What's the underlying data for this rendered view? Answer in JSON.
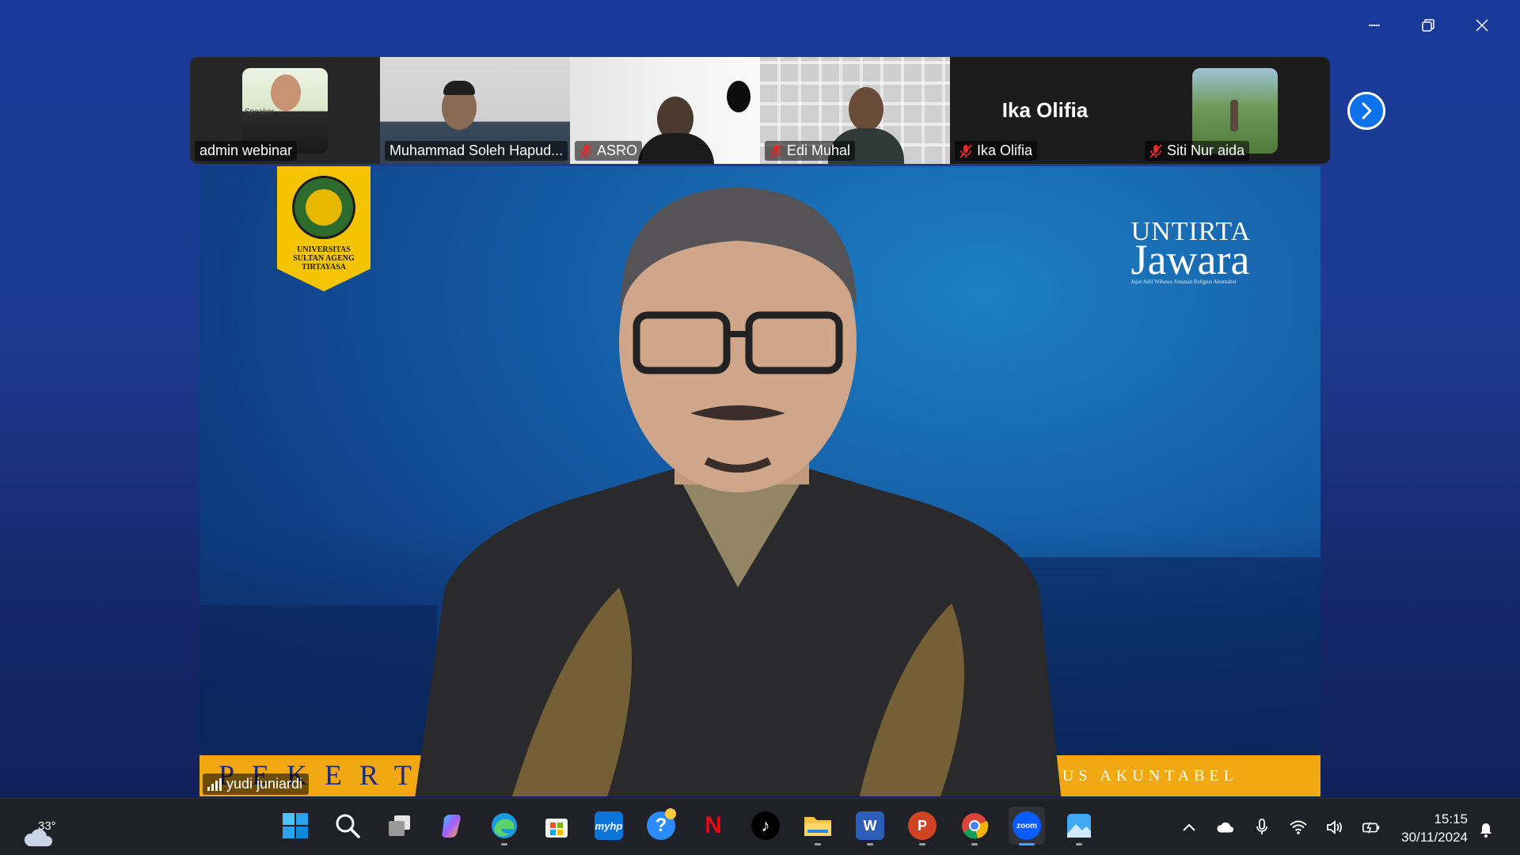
{
  "window_controls": {
    "minimize_label": "—",
    "restore_label": "❐",
    "close_label": "✕"
  },
  "participants": [
    {
      "name": "admin webinar",
      "muted": false,
      "photo_text": "Speaker"
    },
    {
      "name": "Muhammad Soleh Hapud...",
      "muted": false
    },
    {
      "name": "ASRO",
      "muted": true
    },
    {
      "name": "Edi Muhal",
      "muted": true
    },
    {
      "name": "Ika Olifia",
      "muted": true,
      "center_name": "Ika Olifia"
    },
    {
      "name": "Siti Nur aida",
      "muted": true
    }
  ],
  "main_video": {
    "speaker_name": "yudi juniardi",
    "logo_text_lines": [
      "UNIVERSITAS",
      "SULTAN AGENG",
      "TIRTAYASA"
    ],
    "brand_line1": "UNTIRTA",
    "brand_line2": "Jawara",
    "brand_tagline": "Jujur Adil Wibawa Amanah Religius Akuntabel",
    "band_left": "PEKERTI",
    "band_right": "US AKUNTABEL"
  },
  "taskbar": {
    "weather_temp": "33°",
    "apps": [
      {
        "id": "start",
        "icon": "windows-start-icon",
        "color": "#3aa0ff",
        "label": "",
        "running": false
      },
      {
        "id": "search",
        "icon": "search-icon",
        "color": "#ffffff",
        "label": "",
        "running": false
      },
      {
        "id": "taskview",
        "icon": "task-view-icon",
        "color": "#cccccc",
        "label": "",
        "running": false
      },
      {
        "id": "copilot",
        "icon": "copilot-icon",
        "color": "#8b5cf6",
        "label": "",
        "running": false
      },
      {
        "id": "edge",
        "icon": "edge-icon",
        "color": "#1a9ae0",
        "label": "",
        "running": true
      },
      {
        "id": "store",
        "icon": "store-icon",
        "color": "#ffffff",
        "label": "",
        "running": false
      },
      {
        "id": "myhp",
        "icon": "myhp-icon",
        "color": "#0b74d6",
        "label": "myhp",
        "running": false
      },
      {
        "id": "help",
        "icon": "help-icon",
        "color": "#2a8cff",
        "label": "?",
        "running": false
      },
      {
        "id": "netflix",
        "icon": "netflix-icon",
        "color": "#e50914",
        "label": "N",
        "running": false
      },
      {
        "id": "tiktok",
        "icon": "tiktok-icon",
        "color": "#000000",
        "label": "♪",
        "running": false
      },
      {
        "id": "explorer",
        "icon": "file-explorer-icon",
        "color": "#f3c246",
        "label": "",
        "running": true
      },
      {
        "id": "word",
        "icon": "word-icon",
        "color": "#2b5fb8",
        "label": "W",
        "running": true
      },
      {
        "id": "powerpoint",
        "icon": "powerpoint-icon",
        "color": "#d04423",
        "label": "P",
        "running": true
      },
      {
        "id": "chrome",
        "icon": "chrome-icon",
        "color": "#34a853",
        "label": "",
        "running": true
      },
      {
        "id": "zoom",
        "icon": "zoom-icon",
        "color": "#0b5cff",
        "label": "zoom",
        "running": true,
        "active": true
      },
      {
        "id": "photos",
        "icon": "photos-icon",
        "color": "#3fa9f5",
        "label": "",
        "running": true
      }
    ],
    "clock_time": "15:15",
    "clock_date": "30/11/2024"
  }
}
